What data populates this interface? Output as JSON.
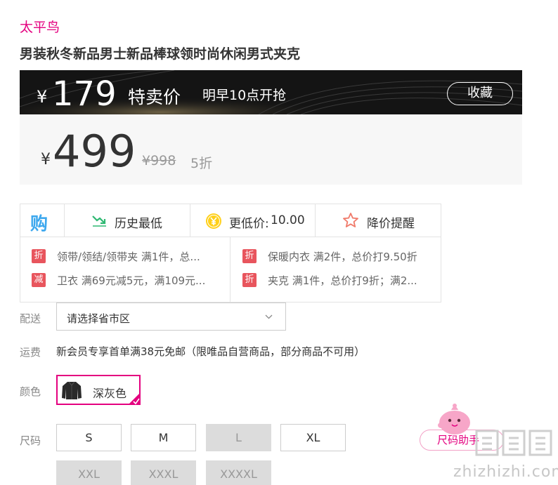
{
  "product": {
    "brand": "太平鸟",
    "title": "男装秋冬新品男士新品棒球领时尚休闲男式夹克"
  },
  "sale": {
    "currency": "¥",
    "price": "179",
    "label": "特卖价",
    "start_time": "明早10点开抢",
    "favorite_label": "收藏"
  },
  "pricing": {
    "currency": "¥",
    "price": "499",
    "original_price": "¥998",
    "discount": "5折"
  },
  "promotions": {
    "header": {
      "icon_label": "购",
      "history_low": "历史最低",
      "cheaper_label": "更低价:",
      "cheaper_value": "10.00",
      "price_alert": "降价提醒"
    },
    "items": [
      {
        "tag": "折",
        "text": "领带/领结/领带夹 满1件，总..."
      },
      {
        "tag": "减",
        "text": "卫衣 满69元减5元，满109元..."
      },
      {
        "tag": "折",
        "text": "保暖内衣 满2件，总价打9.50折"
      },
      {
        "tag": "折",
        "text": "夹克 满1件，总价打9折；满2..."
      }
    ]
  },
  "delivery": {
    "label": "配送",
    "placeholder": "请选择省市区"
  },
  "shipping": {
    "label": "运费",
    "text": "新会员专享首单满38元免邮（限唯品自营商品，部分商品不可用）"
  },
  "color": {
    "label": "颜色",
    "selected": "深灰色"
  },
  "size": {
    "label": "尺码",
    "options": [
      {
        "label": "S",
        "available": true
      },
      {
        "label": "M",
        "available": true
      },
      {
        "label": "L",
        "available": false
      },
      {
        "label": "XL",
        "available": true
      },
      {
        "label": "XXL",
        "available": false
      },
      {
        "label": "XXXL",
        "available": false
      },
      {
        "label": "XXXXL",
        "available": false
      }
    ],
    "guide_label": "尺码助手"
  },
  "watermark": "zhizhizhi.com",
  "colors": {
    "accent": "#e4007f",
    "tag_red": "#e8555d",
    "sale_bar": "#141414",
    "disabled": "#dcdcdc"
  },
  "icons": [
    "trend-down-icon",
    "yen-coin-icon",
    "star-icon",
    "chevron-down-icon",
    "check-icon",
    "jacket-thumbnail"
  ]
}
